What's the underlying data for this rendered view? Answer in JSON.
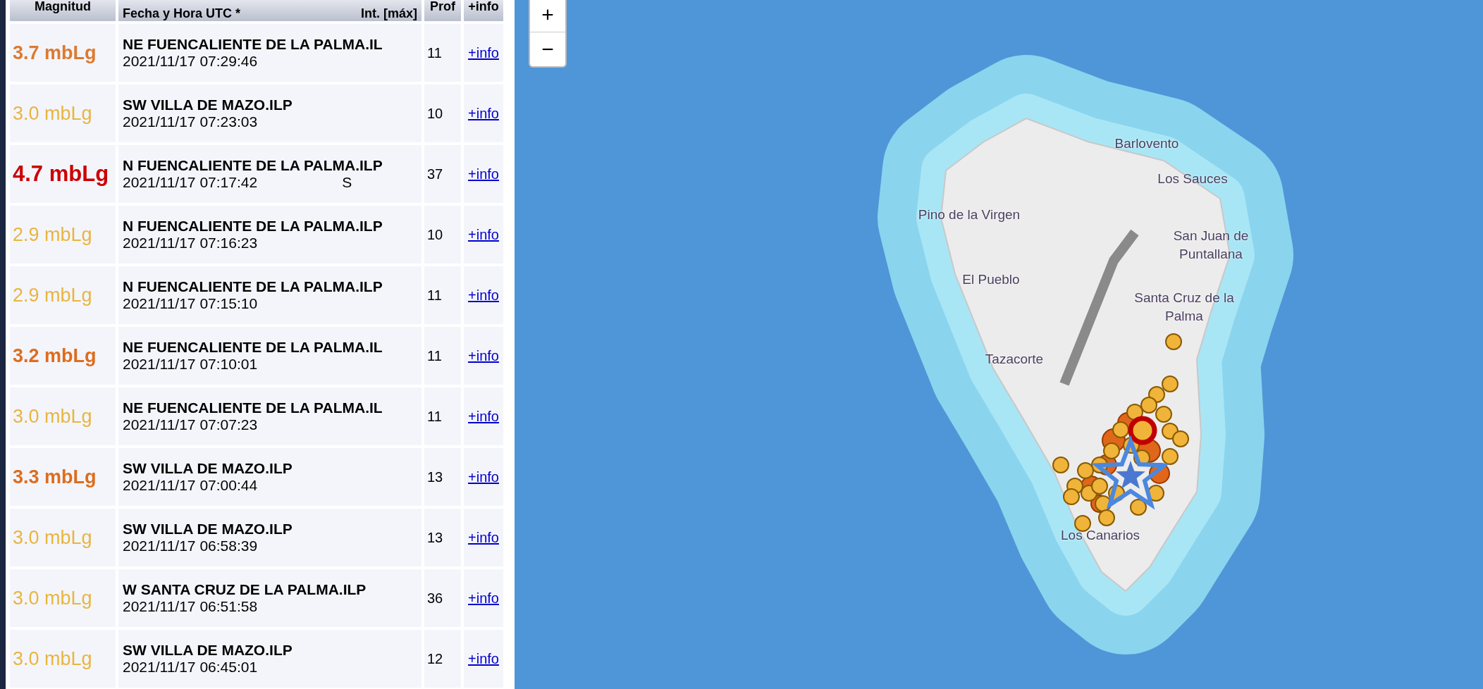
{
  "table": {
    "columns": [
      "Magnitud",
      "Fecha y Hora UTC *",
      "Int. [máx]",
      "Prof",
      "+info"
    ],
    "rows": [
      {
        "magnitude": "3.7 mbLg",
        "kind": "moderate",
        "color": "#dd7a30",
        "location": "NE FUENCALIENTE DE LA PALMA.IL",
        "datetime": "2021/11/17 07:29:46",
        "depth": "11",
        "link": "+info"
      },
      {
        "magnitude": "3.0 mbLg",
        "kind": "minor",
        "color": "#e8b540",
        "location": "SW VILLA DE MAZO.ILP",
        "datetime": "2021/11/17 07:23:03",
        "depth": "10",
        "link": "+info"
      },
      {
        "magnitude": "4.7 mbLg",
        "kind": "strong",
        "color": "#cc0000",
        "location": "N FUENCALIENTE DE LA PALMA.ILP",
        "datetime": "2021/11/17 07:17:42",
        "intensity": "S",
        "depth": "37",
        "link": "+info"
      },
      {
        "magnitude": "2.9 mbLg",
        "kind": "minor",
        "color": "#e8b540",
        "location": "N FUENCALIENTE DE LA PALMA.ILP",
        "datetime": "2021/11/17 07:16:23",
        "depth": "10",
        "link": "+info"
      },
      {
        "magnitude": "2.9 mbLg",
        "kind": "minor",
        "color": "#e8b540",
        "location": "N FUENCALIENTE DE LA PALMA.ILP",
        "datetime": "2021/11/17 07:15:10",
        "depth": "11",
        "link": "+info"
      },
      {
        "magnitude": "3.2 mbLg",
        "kind": "moderate",
        "color": "#dd6d1e",
        "location": "NE FUENCALIENTE DE LA PALMA.IL",
        "datetime": "2021/11/17 07:10:01",
        "depth": "11",
        "link": "+info"
      },
      {
        "magnitude": "3.0 mbLg",
        "kind": "minor",
        "color": "#e8b540",
        "location": "NE FUENCALIENTE DE LA PALMA.IL",
        "datetime": "2021/11/17 07:07:23",
        "depth": "11",
        "link": "+info"
      },
      {
        "magnitude": "3.3 mbLg",
        "kind": "moderate",
        "color": "#dd6d1e",
        "location": "SW VILLA DE MAZO.ILP",
        "datetime": "2021/11/17 07:00:44",
        "depth": "13",
        "link": "+info"
      },
      {
        "magnitude": "3.0 mbLg",
        "kind": "minor",
        "color": "#e8b540",
        "location": "SW VILLA DE MAZO.ILP",
        "datetime": "2021/11/17 06:58:39",
        "depth": "13",
        "link": "+info"
      },
      {
        "magnitude": "3.0 mbLg",
        "kind": "minor",
        "color": "#e8b540",
        "location": "W SANTA CRUZ DE LA PALMA.ILP",
        "datetime": "2021/11/17 06:51:58",
        "depth": "36",
        "link": "+info"
      },
      {
        "magnitude": "3.0 mbLg",
        "kind": "minor",
        "color": "#e8b540",
        "location": "SW VILLA DE MAZO.ILP",
        "datetime": "2021/11/17 06:45:01",
        "depth": "12",
        "link": "+info"
      }
    ]
  },
  "map": {
    "zoom_in": "+",
    "zoom_out": "−",
    "places": [
      "Barlovento",
      "Los Sauces",
      "Pino de la Virgen",
      "San Juan de Puntallana",
      "El Pueblo",
      "Santa Cruz de la Palma",
      "Tazacorte",
      "Los Canarios"
    ]
  }
}
